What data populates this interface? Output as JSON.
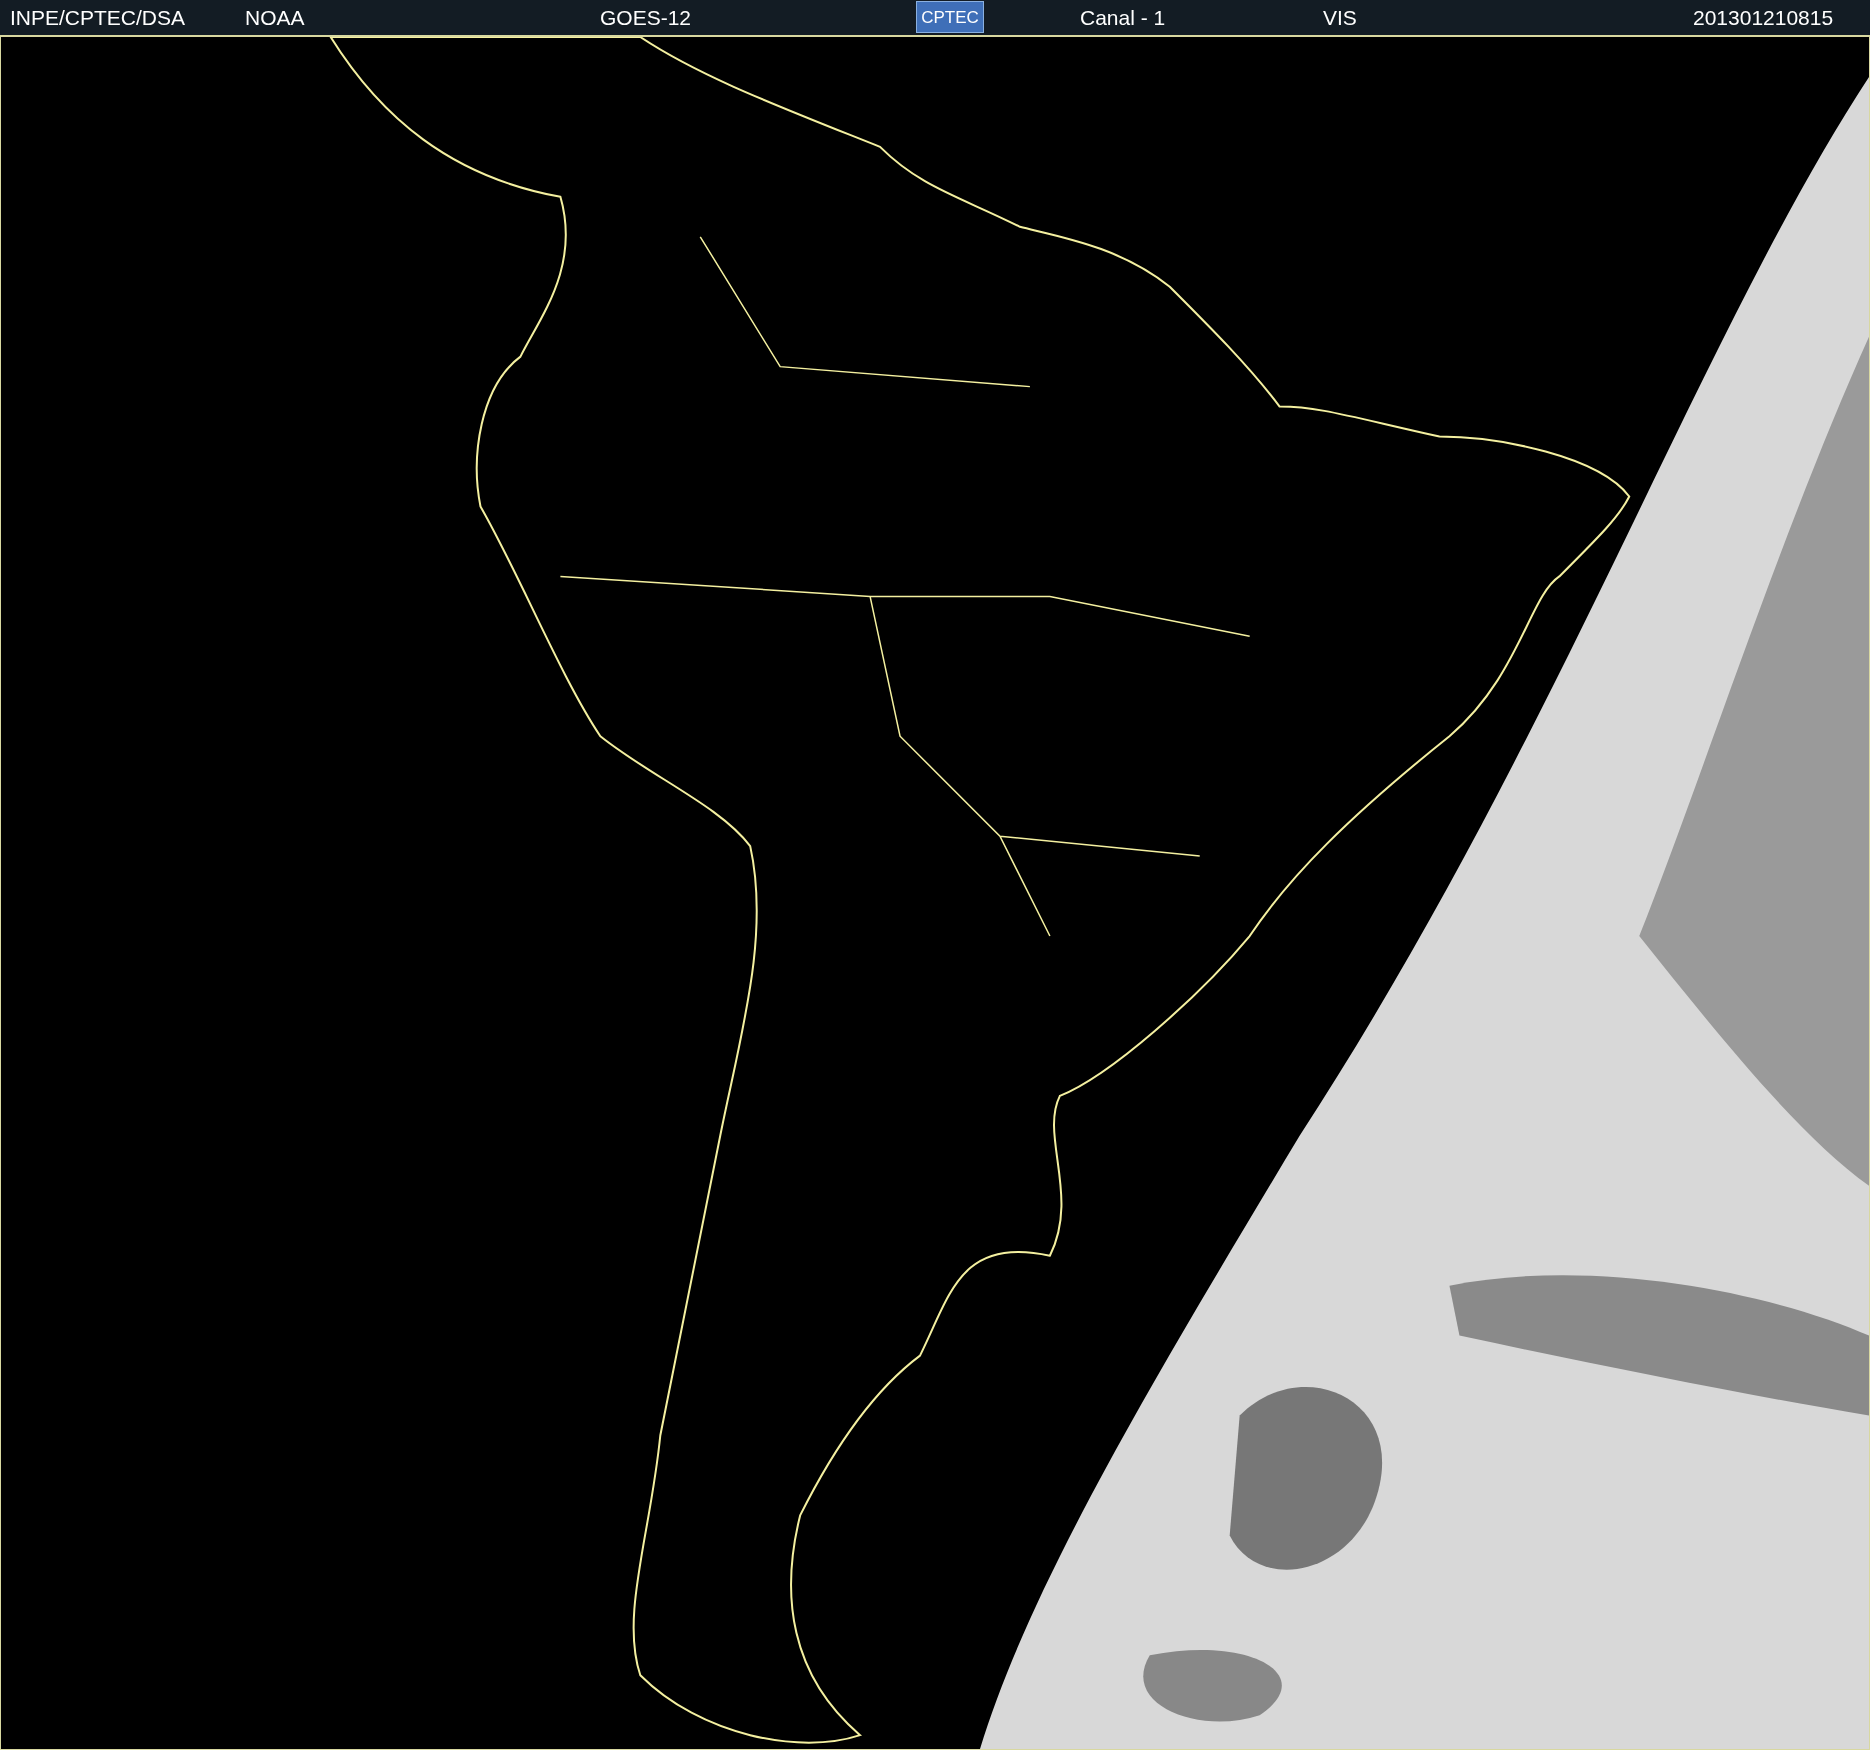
{
  "header": {
    "source": "INPE/CPTEC/DSA",
    "agency": "NOAA",
    "satellite": "GOES-12",
    "logo": "CPTEC",
    "channel": "Canal - 1",
    "band": "VIS",
    "timestamp": "201301210815"
  }
}
